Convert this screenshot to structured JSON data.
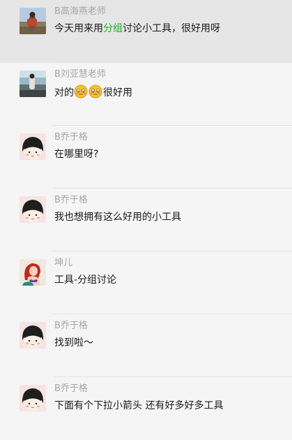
{
  "messages": [
    {
      "sender": "B高海燕老师",
      "text_before": "今天用来用",
      "highlight": "分组",
      "text_after": "讨论小工具，很好用呀",
      "avatar": "landscape-photo-avatar"
    },
    {
      "sender": "B刘亚慧老师",
      "text_before": "对的",
      "emojis": [
        "embarrassed-emoji-icon",
        "embarrassed-emoji-icon"
      ],
      "text_after": "很好用",
      "avatar": "seaside-photo-avatar"
    },
    {
      "sender": "B乔于格",
      "text": "在哪里呀?",
      "avatar": "cartoon-girl-avatar"
    },
    {
      "sender": "B乔于格",
      "text": "我也想拥有这么好用的小工具",
      "avatar": "cartoon-girl-avatar"
    },
    {
      "sender": "坤儿",
      "text": "工具-分组讨论",
      "avatar": "mermaid-avatar"
    },
    {
      "sender": "B乔于格",
      "text": "找到啦～",
      "avatar": "cartoon-girl-avatar"
    },
    {
      "sender": "B乔于格",
      "text": "下面有个下拉小箭头 还有好多好多工具",
      "avatar": "cartoon-girl-avatar"
    }
  ],
  "colors": {
    "highlight": "#1aad19",
    "sender": "#a6a6a6",
    "text": "#1a1a1a",
    "selected_bg": "#e6e6e6",
    "bg": "#f5f5f5"
  }
}
